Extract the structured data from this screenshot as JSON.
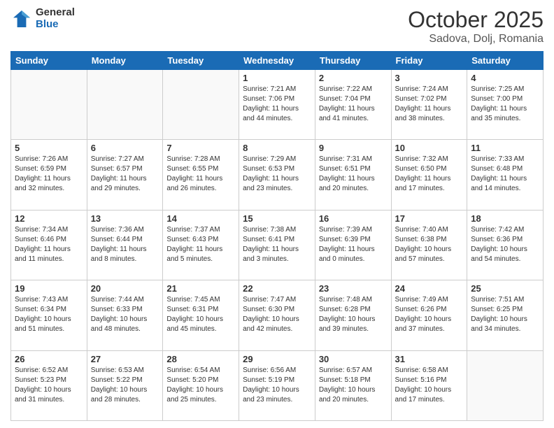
{
  "header": {
    "logo_general": "General",
    "logo_blue": "Blue",
    "month_title": "October 2025",
    "location": "Sadova, Dolj, Romania"
  },
  "days_of_week": [
    "Sunday",
    "Monday",
    "Tuesday",
    "Wednesday",
    "Thursday",
    "Friday",
    "Saturday"
  ],
  "weeks": [
    [
      {
        "day": "",
        "info": ""
      },
      {
        "day": "",
        "info": ""
      },
      {
        "day": "",
        "info": ""
      },
      {
        "day": "1",
        "info": "Sunrise: 7:21 AM\nSunset: 7:06 PM\nDaylight: 11 hours and 44 minutes."
      },
      {
        "day": "2",
        "info": "Sunrise: 7:22 AM\nSunset: 7:04 PM\nDaylight: 11 hours and 41 minutes."
      },
      {
        "day": "3",
        "info": "Sunrise: 7:24 AM\nSunset: 7:02 PM\nDaylight: 11 hours and 38 minutes."
      },
      {
        "day": "4",
        "info": "Sunrise: 7:25 AM\nSunset: 7:00 PM\nDaylight: 11 hours and 35 minutes."
      }
    ],
    [
      {
        "day": "5",
        "info": "Sunrise: 7:26 AM\nSunset: 6:59 PM\nDaylight: 11 hours and 32 minutes."
      },
      {
        "day": "6",
        "info": "Sunrise: 7:27 AM\nSunset: 6:57 PM\nDaylight: 11 hours and 29 minutes."
      },
      {
        "day": "7",
        "info": "Sunrise: 7:28 AM\nSunset: 6:55 PM\nDaylight: 11 hours and 26 minutes."
      },
      {
        "day": "8",
        "info": "Sunrise: 7:29 AM\nSunset: 6:53 PM\nDaylight: 11 hours and 23 minutes."
      },
      {
        "day": "9",
        "info": "Sunrise: 7:31 AM\nSunset: 6:51 PM\nDaylight: 11 hours and 20 minutes."
      },
      {
        "day": "10",
        "info": "Sunrise: 7:32 AM\nSunset: 6:50 PM\nDaylight: 11 hours and 17 minutes."
      },
      {
        "day": "11",
        "info": "Sunrise: 7:33 AM\nSunset: 6:48 PM\nDaylight: 11 hours and 14 minutes."
      }
    ],
    [
      {
        "day": "12",
        "info": "Sunrise: 7:34 AM\nSunset: 6:46 PM\nDaylight: 11 hours and 11 minutes."
      },
      {
        "day": "13",
        "info": "Sunrise: 7:36 AM\nSunset: 6:44 PM\nDaylight: 11 hours and 8 minutes."
      },
      {
        "day": "14",
        "info": "Sunrise: 7:37 AM\nSunset: 6:43 PM\nDaylight: 11 hours and 5 minutes."
      },
      {
        "day": "15",
        "info": "Sunrise: 7:38 AM\nSunset: 6:41 PM\nDaylight: 11 hours and 3 minutes."
      },
      {
        "day": "16",
        "info": "Sunrise: 7:39 AM\nSunset: 6:39 PM\nDaylight: 11 hours and 0 minutes."
      },
      {
        "day": "17",
        "info": "Sunrise: 7:40 AM\nSunset: 6:38 PM\nDaylight: 10 hours and 57 minutes."
      },
      {
        "day": "18",
        "info": "Sunrise: 7:42 AM\nSunset: 6:36 PM\nDaylight: 10 hours and 54 minutes."
      }
    ],
    [
      {
        "day": "19",
        "info": "Sunrise: 7:43 AM\nSunset: 6:34 PM\nDaylight: 10 hours and 51 minutes."
      },
      {
        "day": "20",
        "info": "Sunrise: 7:44 AM\nSunset: 6:33 PM\nDaylight: 10 hours and 48 minutes."
      },
      {
        "day": "21",
        "info": "Sunrise: 7:45 AM\nSunset: 6:31 PM\nDaylight: 10 hours and 45 minutes."
      },
      {
        "day": "22",
        "info": "Sunrise: 7:47 AM\nSunset: 6:30 PM\nDaylight: 10 hours and 42 minutes."
      },
      {
        "day": "23",
        "info": "Sunrise: 7:48 AM\nSunset: 6:28 PM\nDaylight: 10 hours and 39 minutes."
      },
      {
        "day": "24",
        "info": "Sunrise: 7:49 AM\nSunset: 6:26 PM\nDaylight: 10 hours and 37 minutes."
      },
      {
        "day": "25",
        "info": "Sunrise: 7:51 AM\nSunset: 6:25 PM\nDaylight: 10 hours and 34 minutes."
      }
    ],
    [
      {
        "day": "26",
        "info": "Sunrise: 6:52 AM\nSunset: 5:23 PM\nDaylight: 10 hours and 31 minutes."
      },
      {
        "day": "27",
        "info": "Sunrise: 6:53 AM\nSunset: 5:22 PM\nDaylight: 10 hours and 28 minutes."
      },
      {
        "day": "28",
        "info": "Sunrise: 6:54 AM\nSunset: 5:20 PM\nDaylight: 10 hours and 25 minutes."
      },
      {
        "day": "29",
        "info": "Sunrise: 6:56 AM\nSunset: 5:19 PM\nDaylight: 10 hours and 23 minutes."
      },
      {
        "day": "30",
        "info": "Sunrise: 6:57 AM\nSunset: 5:18 PM\nDaylight: 10 hours and 20 minutes."
      },
      {
        "day": "31",
        "info": "Sunrise: 6:58 AM\nSunset: 5:16 PM\nDaylight: 10 hours and 17 minutes."
      },
      {
        "day": "",
        "info": ""
      }
    ]
  ]
}
